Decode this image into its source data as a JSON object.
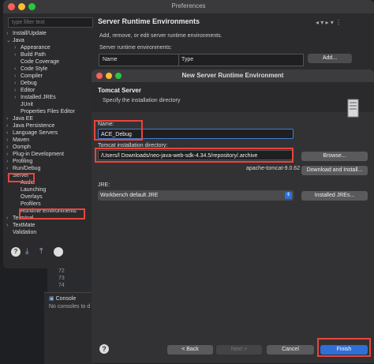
{
  "preferences": {
    "title": "Preferences",
    "filter_placeholder": "type filter text",
    "tree": [
      {
        "label": "Install/Update",
        "arrow": "›",
        "indent": 0
      },
      {
        "label": "Java",
        "arrow": "⌄",
        "indent": 0
      },
      {
        "label": "Appearance",
        "arrow": "›",
        "indent": 1
      },
      {
        "label": "Build Path",
        "arrow": "›",
        "indent": 1
      },
      {
        "label": "Code Coverage",
        "arrow": "",
        "indent": 1
      },
      {
        "label": "Code Style",
        "arrow": "›",
        "indent": 1
      },
      {
        "label": "Compiler",
        "arrow": "›",
        "indent": 1
      },
      {
        "label": "Debug",
        "arrow": "›",
        "indent": 1
      },
      {
        "label": "Editor",
        "arrow": "›",
        "indent": 1
      },
      {
        "label": "Installed JREs",
        "arrow": "›",
        "indent": 1
      },
      {
        "label": "JUnit",
        "arrow": "",
        "indent": 1
      },
      {
        "label": "Properties Files Editor",
        "arrow": "",
        "indent": 1
      },
      {
        "label": "Java EE",
        "arrow": "›",
        "indent": 0
      },
      {
        "label": "Java Persistence",
        "arrow": "›",
        "indent": 0
      },
      {
        "label": "Language Servers",
        "arrow": "›",
        "indent": 0
      },
      {
        "label": "Maven",
        "arrow": "›",
        "indent": 0
      },
      {
        "label": "Oomph",
        "arrow": "›",
        "indent": 0
      },
      {
        "label": "Plug-in Development",
        "arrow": "›",
        "indent": 0
      },
      {
        "label": "Profiling",
        "arrow": "›",
        "indent": 0
      },
      {
        "label": "Run/Debug",
        "arrow": "›",
        "indent": 0
      },
      {
        "label": "Server",
        "arrow": "⌄",
        "indent": 0
      },
      {
        "label": "Audio",
        "arrow": "",
        "indent": 1
      },
      {
        "label": "Launching",
        "arrow": "",
        "indent": 1
      },
      {
        "label": "Overlays",
        "arrow": "",
        "indent": 1
      },
      {
        "label": "Profilers",
        "arrow": "",
        "indent": 1
      },
      {
        "label": "Runtime Environments",
        "arrow": "",
        "indent": 1
      },
      {
        "label": "Terminal",
        "arrow": "›",
        "indent": 0
      },
      {
        "label": "TextMate",
        "arrow": "›",
        "indent": 0
      },
      {
        "label": "Validation",
        "arrow": "",
        "indent": 0
      }
    ],
    "page_title": "Server Runtime Environments",
    "description": "Add, remove, or edit server runtime environments.",
    "env_label": "Server runtime environments:",
    "table_headers": [
      "Name",
      "Type"
    ],
    "add_button": "Add..."
  },
  "editor": {
    "line_numbers": [
      "72",
      "73",
      "74"
    ]
  },
  "console": {
    "title": "Console",
    "empty_text": "No consoles to d"
  },
  "dialog": {
    "title": "New Server Runtime Environment",
    "header_title": "Tomcat Server",
    "header_subtitle": "Specify the installation directory",
    "name_label": "Name:",
    "name_value": "ACE_Debug",
    "install_dir_label": "Tomcat installation directory:",
    "install_dir_value": "/Users/l          Downloads/neo-java-web-sdk-4.34.5/repository/.archive",
    "browse_button": "Browse...",
    "version_text": "apache-tomcat-9.0.62",
    "download_button": "Download and Install...",
    "jre_label": "JRE:",
    "jre_value": "Workbench default JRE",
    "installed_jres_button": "Installed JREs...",
    "back_button": "< Back",
    "next_button": "Next >",
    "cancel_button": "Cancel",
    "finish_button": "Finish"
  },
  "colors": {
    "highlight": "#e8453c",
    "accent": "#2f6fd8",
    "focus": "#3d7fd6"
  }
}
